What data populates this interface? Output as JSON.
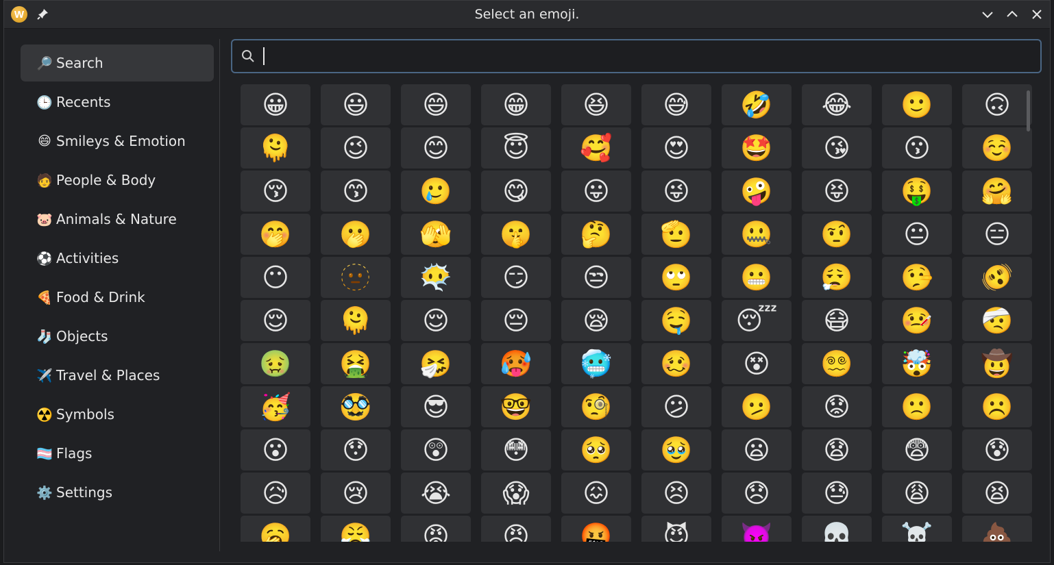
{
  "window": {
    "title": "Select an emoji.",
    "logo_letter": "W"
  },
  "sidebar": {
    "items": [
      {
        "icon": "🔎",
        "label": "Search",
        "active": true
      },
      {
        "icon": "🕒",
        "label": "Recents"
      },
      {
        "icon": "😄",
        "label": "Smileys & Emotion"
      },
      {
        "icon": "🧑",
        "label": "People & Body"
      },
      {
        "icon": "🐷",
        "label": "Animals & Nature"
      },
      {
        "icon": "⚽",
        "label": "Activities"
      },
      {
        "icon": "🍕",
        "label": "Food & Drink"
      },
      {
        "icon": "🧦",
        "label": "Objects"
      },
      {
        "icon": "✈️",
        "label": "Travel & Places"
      },
      {
        "icon": "☢️",
        "label": "Symbols"
      },
      {
        "icon": "🏳️‍⚧️",
        "label": "Flags"
      },
      {
        "icon": "⚙️",
        "label": "Settings"
      }
    ]
  },
  "search": {
    "value": "",
    "placeholder": ""
  },
  "emojis": [
    "😀",
    "😃",
    "😄",
    "😁",
    "😆",
    "😅",
    "🤣",
    "😂",
    "🙂",
    "🙃",
    "🫠",
    "😉",
    "😊",
    "😇",
    "🥰",
    "😍",
    "🤩",
    "😘",
    "😗",
    "☺️",
    "😚",
    "😙",
    "🥲",
    "😋",
    "😛",
    "😜",
    "🤪",
    "😝",
    "🤑",
    "🤗",
    "🤭",
    "🫢",
    "🫣",
    "🤫",
    "🤔",
    "🫡",
    "🤐",
    "🤨",
    "😐",
    "😑",
    "😶",
    "🫥",
    "😶‍🌫️",
    "😏",
    "😒",
    "🙄",
    "😬",
    "😮‍💨",
    "🤥",
    "🫨",
    "😌",
    "🫠",
    "😌",
    "😔",
    "😪",
    "🤤",
    "😴",
    "😷",
    "🤒",
    "🤕",
    "🤢",
    "🤮",
    "🤧",
    "🥵",
    "🥶",
    "🥴",
    "😵",
    "😵‍💫",
    "🤯",
    "🤠",
    "🥳",
    "🥸",
    "😎",
    "🤓",
    "🧐",
    "😕",
    "🫤",
    "😟",
    "🙁",
    "☹️",
    "😮",
    "😯",
    "😲",
    "😳",
    "🥺",
    "🥹",
    "😦",
    "😧",
    "😨",
    "😰",
    "😥",
    "😢",
    "😭",
    "😱",
    "😖",
    "😣",
    "😞",
    "😓",
    "😩",
    "😫",
    "🥱",
    "😤",
    "😡",
    "😠",
    "🤬",
    "😈",
    "👿",
    "💀",
    "☠️",
    "💩"
  ],
  "colors": {
    "accent": "#4a6684",
    "active_item": "#36373a",
    "cell_bg": "#303134"
  }
}
